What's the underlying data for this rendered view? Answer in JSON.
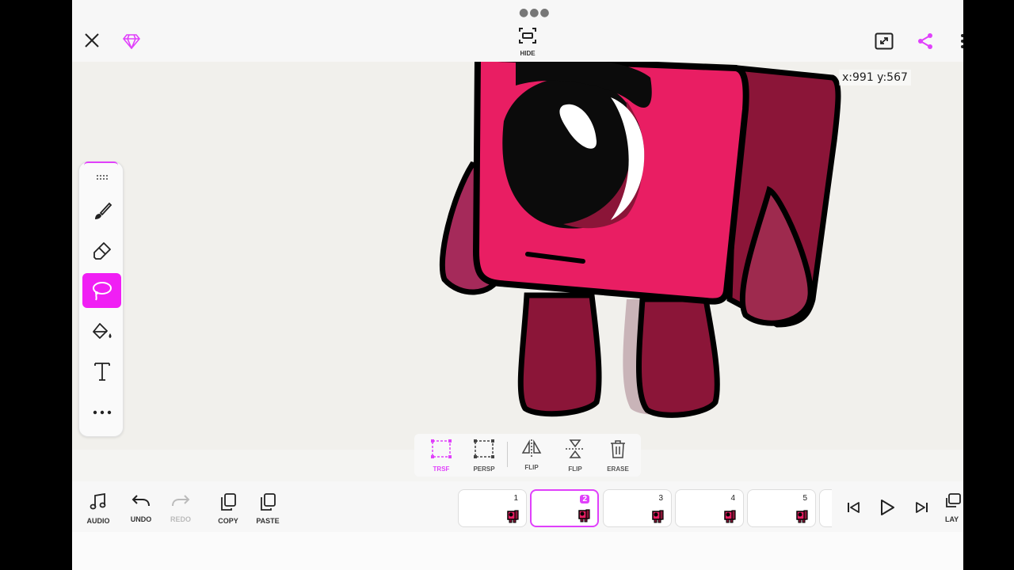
{
  "topbar": {
    "hide_label": "HIDE",
    "icons": {
      "close": "close-icon",
      "premium": "diamond-icon",
      "fullscreen": "expand-icon",
      "share": "share-icon"
    }
  },
  "canvas": {
    "coords": "x:991 y:567"
  },
  "tools": [
    "drag-handle",
    "brush",
    "eraser",
    "lasso",
    "fill",
    "text",
    "more"
  ],
  "active_tool": "lasso",
  "transform": {
    "items": [
      {
        "label": "TRSF",
        "icon": "transform-icon"
      },
      {
        "label": "PERSP",
        "icon": "perspective-icon"
      },
      {
        "label": "FLIP",
        "icon": "flip-horizontal-icon"
      },
      {
        "label": "FLIP",
        "icon": "flip-vertical-icon"
      },
      {
        "label": "ERASE",
        "icon": "trash-icon"
      }
    ]
  },
  "bottom": {
    "audio": "AUDIO",
    "undo": "UNDO",
    "redo": "REDO",
    "copy": "COPY",
    "paste": "PASTE",
    "layers": "LAY"
  },
  "frames": [
    {
      "number": "1"
    },
    {
      "number": "2"
    },
    {
      "number": "3"
    },
    {
      "number": "4"
    },
    {
      "number": "5"
    }
  ],
  "selected_frame": "2",
  "colors": {
    "accent": "#e040fb",
    "character_main": "#e91e63",
    "character_dark": "#8b1538"
  }
}
